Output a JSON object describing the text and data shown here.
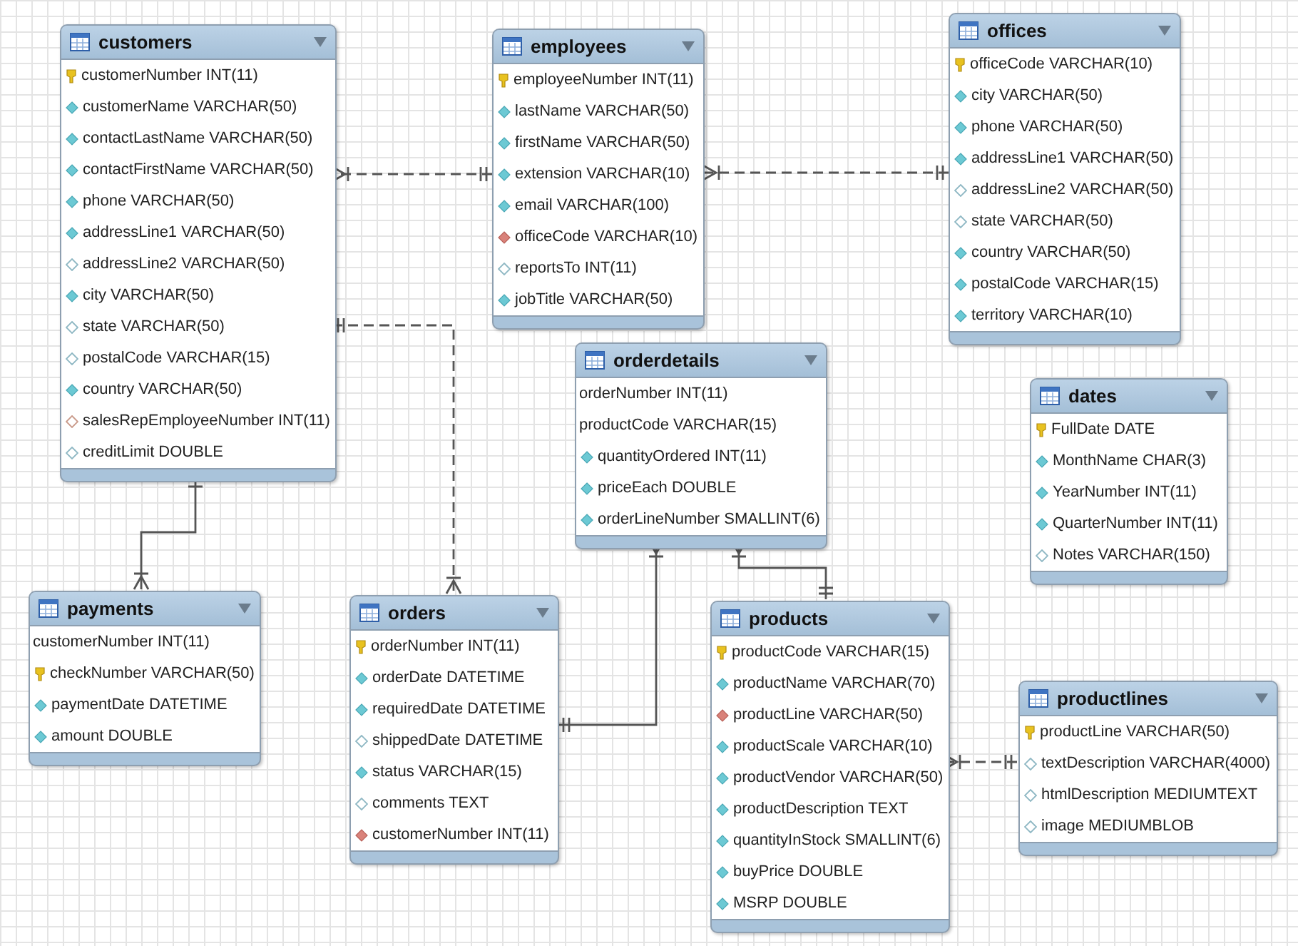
{
  "tables": [
    {
      "name": "customers",
      "columns": [
        {
          "text": "customerNumber INT(11)",
          "kind": "pk"
        },
        {
          "text": "customerName VARCHAR(50)",
          "kind": "nn"
        },
        {
          "text": "contactLastName VARCHAR(50)",
          "kind": "nn"
        },
        {
          "text": "contactFirstName VARCHAR(50)",
          "kind": "nn"
        },
        {
          "text": "phone VARCHAR(50)",
          "kind": "nn"
        },
        {
          "text": "addressLine1 VARCHAR(50)",
          "kind": "nn"
        },
        {
          "text": "addressLine2 VARCHAR(50)",
          "kind": "null"
        },
        {
          "text": "city VARCHAR(50)",
          "kind": "nn"
        },
        {
          "text": "state VARCHAR(50)",
          "kind": "null"
        },
        {
          "text": "postalCode VARCHAR(15)",
          "kind": "null"
        },
        {
          "text": "country VARCHAR(50)",
          "kind": "nn"
        },
        {
          "text": "salesRepEmployeeNumber INT(11)",
          "kind": "fknull"
        },
        {
          "text": "creditLimit DOUBLE",
          "kind": "null"
        }
      ]
    },
    {
      "name": "employees",
      "columns": [
        {
          "text": "employeeNumber INT(11)",
          "kind": "pk"
        },
        {
          "text": "lastName VARCHAR(50)",
          "kind": "nn"
        },
        {
          "text": "firstName VARCHAR(50)",
          "kind": "nn"
        },
        {
          "text": "extension VARCHAR(10)",
          "kind": "nn"
        },
        {
          "text": "email VARCHAR(100)",
          "kind": "nn"
        },
        {
          "text": "officeCode VARCHAR(10)",
          "kind": "fk"
        },
        {
          "text": "reportsTo INT(11)",
          "kind": "null"
        },
        {
          "text": "jobTitle VARCHAR(50)",
          "kind": "nn"
        }
      ]
    },
    {
      "name": "offices",
      "columns": [
        {
          "text": "officeCode VARCHAR(10)",
          "kind": "pk"
        },
        {
          "text": "city VARCHAR(50)",
          "kind": "nn"
        },
        {
          "text": "phone VARCHAR(50)",
          "kind": "nn"
        },
        {
          "text": "addressLine1 VARCHAR(50)",
          "kind": "nn"
        },
        {
          "text": "addressLine2 VARCHAR(50)",
          "kind": "null"
        },
        {
          "text": "state VARCHAR(50)",
          "kind": "null"
        },
        {
          "text": "country VARCHAR(50)",
          "kind": "nn"
        },
        {
          "text": "postalCode VARCHAR(15)",
          "kind": "nn"
        },
        {
          "text": "territory VARCHAR(10)",
          "kind": "nn"
        }
      ]
    },
    {
      "name": "orderdetails",
      "columns": [
        {
          "text": "orderNumber INT(11)",
          "kind": "plain"
        },
        {
          "text": "productCode VARCHAR(15)",
          "kind": "plain"
        },
        {
          "text": "quantityOrdered INT(11)",
          "kind": "nn"
        },
        {
          "text": "priceEach DOUBLE",
          "kind": "nn"
        },
        {
          "text": "orderLineNumber SMALLINT(6)",
          "kind": "nn"
        }
      ]
    },
    {
      "name": "dates",
      "columns": [
        {
          "text": "FullDate DATE",
          "kind": "pk"
        },
        {
          "text": "MonthName CHAR(3)",
          "kind": "nn"
        },
        {
          "text": "YearNumber INT(11)",
          "kind": "nn"
        },
        {
          "text": "QuarterNumber INT(11)",
          "kind": "nn"
        },
        {
          "text": "Notes VARCHAR(150)",
          "kind": "null"
        }
      ]
    },
    {
      "name": "payments",
      "columns": [
        {
          "text": "customerNumber INT(11)",
          "kind": "plain"
        },
        {
          "text": "checkNumber VARCHAR(50)",
          "kind": "pk"
        },
        {
          "text": "paymentDate DATETIME",
          "kind": "nn"
        },
        {
          "text": "amount DOUBLE",
          "kind": "nn"
        }
      ]
    },
    {
      "name": "orders",
      "columns": [
        {
          "text": "orderNumber INT(11)",
          "kind": "pk"
        },
        {
          "text": "orderDate DATETIME",
          "kind": "nn"
        },
        {
          "text": "requiredDate DATETIME",
          "kind": "nn"
        },
        {
          "text": "shippedDate DATETIME",
          "kind": "null"
        },
        {
          "text": "status VARCHAR(15)",
          "kind": "nn"
        },
        {
          "text": "comments TEXT",
          "kind": "null"
        },
        {
          "text": "customerNumber INT(11)",
          "kind": "fk"
        }
      ]
    },
    {
      "name": "products",
      "columns": [
        {
          "text": "productCode VARCHAR(15)",
          "kind": "pk"
        },
        {
          "text": "productName VARCHAR(70)",
          "kind": "nn"
        },
        {
          "text": "productLine VARCHAR(50)",
          "kind": "fk"
        },
        {
          "text": "productScale VARCHAR(10)",
          "kind": "nn"
        },
        {
          "text": "productVendor VARCHAR(50)",
          "kind": "nn"
        },
        {
          "text": "productDescription TEXT",
          "kind": "nn"
        },
        {
          "text": "quantityInStock SMALLINT(6)",
          "kind": "nn"
        },
        {
          "text": "buyPrice DOUBLE",
          "kind": "nn"
        },
        {
          "text": "MSRP DOUBLE",
          "kind": "nn"
        }
      ]
    },
    {
      "name": "productlines",
      "columns": [
        {
          "text": "productLine VARCHAR(50)",
          "kind": "pk"
        },
        {
          "text": "textDescription VARCHAR(4000)",
          "kind": "null"
        },
        {
          "text": "htmlDescription MEDIUMTEXT",
          "kind": "null"
        },
        {
          "text": "image MEDIUMBLOB",
          "kind": "null"
        }
      ]
    }
  ],
  "relationships": [
    {
      "identifying": false
    },
    {
      "identifying": false
    },
    {
      "identifying": false
    },
    {
      "identifying": true
    },
    {
      "identifying": true
    },
    {
      "identifying": true
    },
    {
      "identifying": false
    }
  ]
}
